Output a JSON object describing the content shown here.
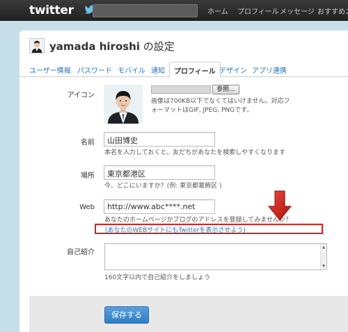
{
  "topbar": {
    "logo": "twitter",
    "nav": [
      "ホーム",
      "プロフィール",
      "メッセージ",
      "おすすめユ"
    ]
  },
  "header": {
    "username": "yamada hiroshi",
    "title_suffix": "の設定"
  },
  "tabs": [
    {
      "label": "ユーザー情報",
      "active": false
    },
    {
      "label": "パスワード",
      "active": false
    },
    {
      "label": "モバイル",
      "active": false
    },
    {
      "label": "通知",
      "active": false
    },
    {
      "label": "プロフィール",
      "active": true
    },
    {
      "label": "デザイン",
      "active": false
    },
    {
      "label": "アプリ連携",
      "active": false
    }
  ],
  "form": {
    "icon": {
      "label": "アイコン",
      "browse_label": "参照...",
      "hint_line1": "画像は700KB以下でなくてはいけません。対応フ",
      "hint_line2": "ォーマットはGIF, JPEG, PNGです。"
    },
    "name": {
      "label": "名前",
      "value": "山田博史",
      "hint": "本名を入力しておくと、友だちがあなたを検索しやすくなります"
    },
    "location": {
      "label": "場所",
      "value": "東京都港区",
      "hint": "今、どこにいますか？(例: 東京都葛飾区 )"
    },
    "web": {
      "label": "Web",
      "value": "http://www.abc****.net",
      "hint": "あなたのホームページかブログのアドレスを登録してみませんか？",
      "link": "(あなたのWEBサイトにもTwitterを表示させよう)"
    },
    "bio": {
      "label": "自己紹介",
      "value": "",
      "hint": "160文字以内で自己紹介をしましょう"
    },
    "save_label": "保存する"
  },
  "colors": {
    "link": "#2276bb",
    "highlight": "#d42020",
    "save_button": "#3d8ad0"
  }
}
